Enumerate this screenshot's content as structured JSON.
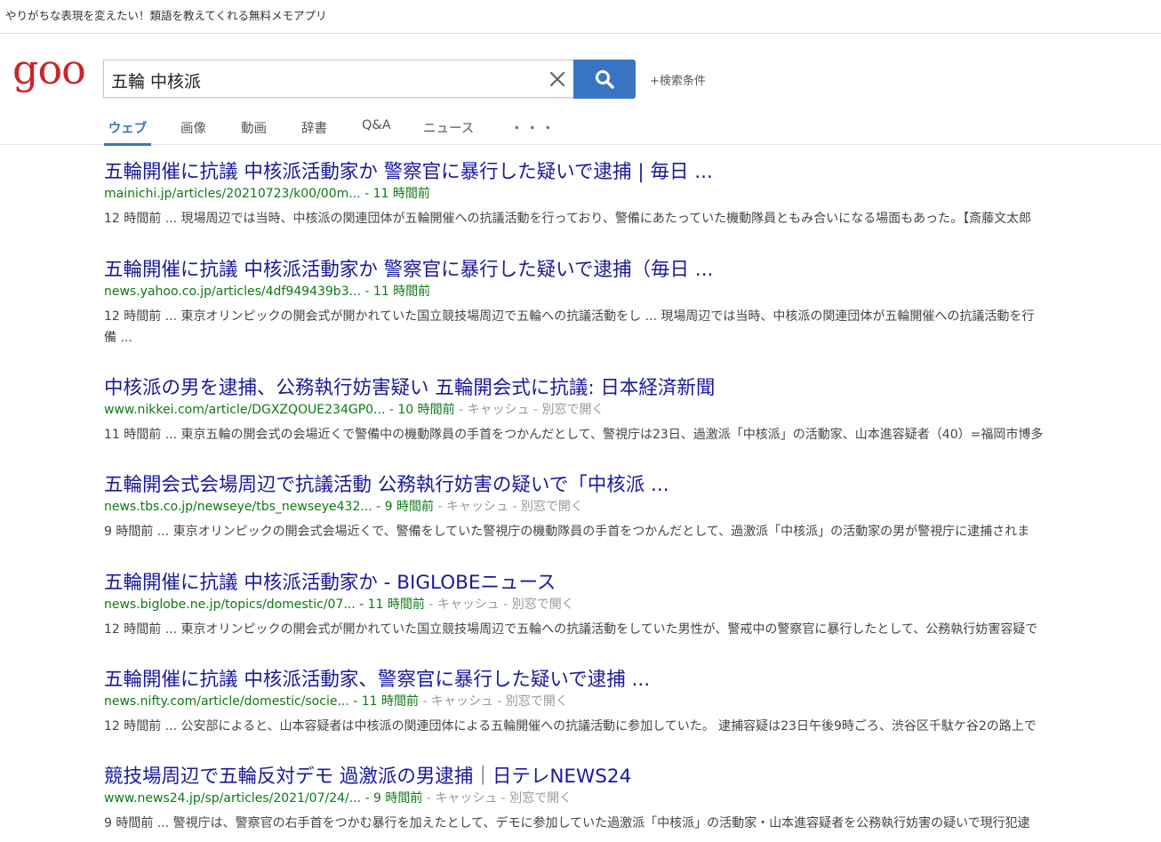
{
  "promo": "やりがちな表現を変えたい！類語を教えてくれる無料メモアプリ",
  "logo_text": "goo",
  "search": {
    "query": "五輪 中核派"
  },
  "advanced_label": "+検索条件",
  "tabs": [
    "ウェブ",
    "画像",
    "動画",
    "辞書",
    "Q&A",
    "ニュース",
    "・・・"
  ],
  "colors": {
    "accent": "#3a75c4",
    "link": "#1a1a9a",
    "url": "#0e7a14",
    "logo_red": "#c8262b"
  },
  "results": [
    {
      "title": "五輪開催に抗議 中核派活動家か 警察官に暴行した疑いで逮捕 | 毎日 ...",
      "url": "mainichi.jp/articles/20210723/k00/00m...",
      "sep": " - ",
      "age": "11 時間前",
      "extra": "",
      "snippet": [
        "12 時間前 ... 現場周辺では当時、中核派の関連団体が五輪開催への抗議活動を行っており、警備にあたっていた機動隊員ともみ合いになる場面もあった。【斎藤文太郎"
      ]
    },
    {
      "title": "五輪開催に抗議 中核派活動家か 警察官に暴行した疑いで逮捕（毎日 ...",
      "url": "news.yahoo.co.jp/articles/4df949439b3...",
      "sep": " - ",
      "age": "11 時間前",
      "extra": "",
      "snippet": [
        "12 時間前 ... 東京オリンピックの開会式が開かれていた国立競技場周辺で五輪への抗議活動をし ... 現場周辺では当時、中核派の関連団体が五輪開催への抗議活動を行",
        "備 ..."
      ]
    },
    {
      "title": "中核派の男を逮捕、公務執行妨害疑い 五輪開会式に抗議: 日本経済新聞",
      "url": "www.nikkei.com/article/DGXZQOUE234GP0...",
      "sep": " - ",
      "age": "10 時間前",
      "extra": " - キャッシュ - 別窓で開く",
      "snippet": [
        "11 時間前 ... 東京五輪の開会式の会場近くで警備中の機動隊員の手首をつかんだとして、警視庁は23日、過激派「中核派」の活動家、山本進容疑者（40）=福岡市博多"
      ]
    },
    {
      "title": "五輪開会式会場周辺で抗議活動 公務執行妨害の疑いで「中核派 ...",
      "url": "news.tbs.co.jp/newseye/tbs_newseye432...",
      "sep": " - ",
      "age": "9 時間前",
      "extra": " - キャッシュ - 別窓で開く",
      "snippet": [
        "9 時間前 ... 東京オリンピックの開会式会場近くで、警備をしていた警視庁の機動隊員の手首をつかんだとして、過激派「中核派」の活動家の男が警視庁に逮捕されま"
      ]
    },
    {
      "title": "五輪開催に抗議 中核派活動家か - BIGLOBEニュース",
      "url": "news.biglobe.ne.jp/topics/domestic/07...",
      "sep": " - ",
      "age": "11 時間前",
      "extra": " - キャッシュ - 別窓で開く",
      "snippet": [
        "12 時間前 ... 東京オリンピックの開会式が開かれていた国立競技場周辺で五輪への抗議活動をしていた男性が、警戒中の警察官に暴行したとして、公務執行妨害容疑で"
      ]
    },
    {
      "title": "五輪開催に抗議 中核派活動家、警察官に暴行した疑いで逮捕 ...",
      "url": "news.nifty.com/article/domestic/socie...",
      "sep": " - ",
      "age": "11 時間前",
      "extra": " - キャッシュ - 別窓で開く",
      "snippet": [
        "12 時間前 ... 公安部によると、山本容疑者は中核派の関連団体による五輪開催への抗議活動に参加していた。 逮捕容疑は23日午後9時ごろ、渋谷区千駄ケ谷2の路上で"
      ]
    },
    {
      "title": "競技場周辺で五輪反対デモ 過激派の男逮捕｜日テレNEWS24",
      "url": "www.news24.jp/sp/articles/2021/07/24/...",
      "sep": " - ",
      "age": "9 時間前",
      "extra": " - キャッシュ - 別窓で開く",
      "snippet": [
        "9 時間前 ... 警視庁は、警察官の右手首をつかむ暴行を加えたとして、デモに参加していた過激派「中核派」の活動家・山本進容疑者を公務執行妨害の疑いで現行犯逮"
      ]
    }
  ]
}
